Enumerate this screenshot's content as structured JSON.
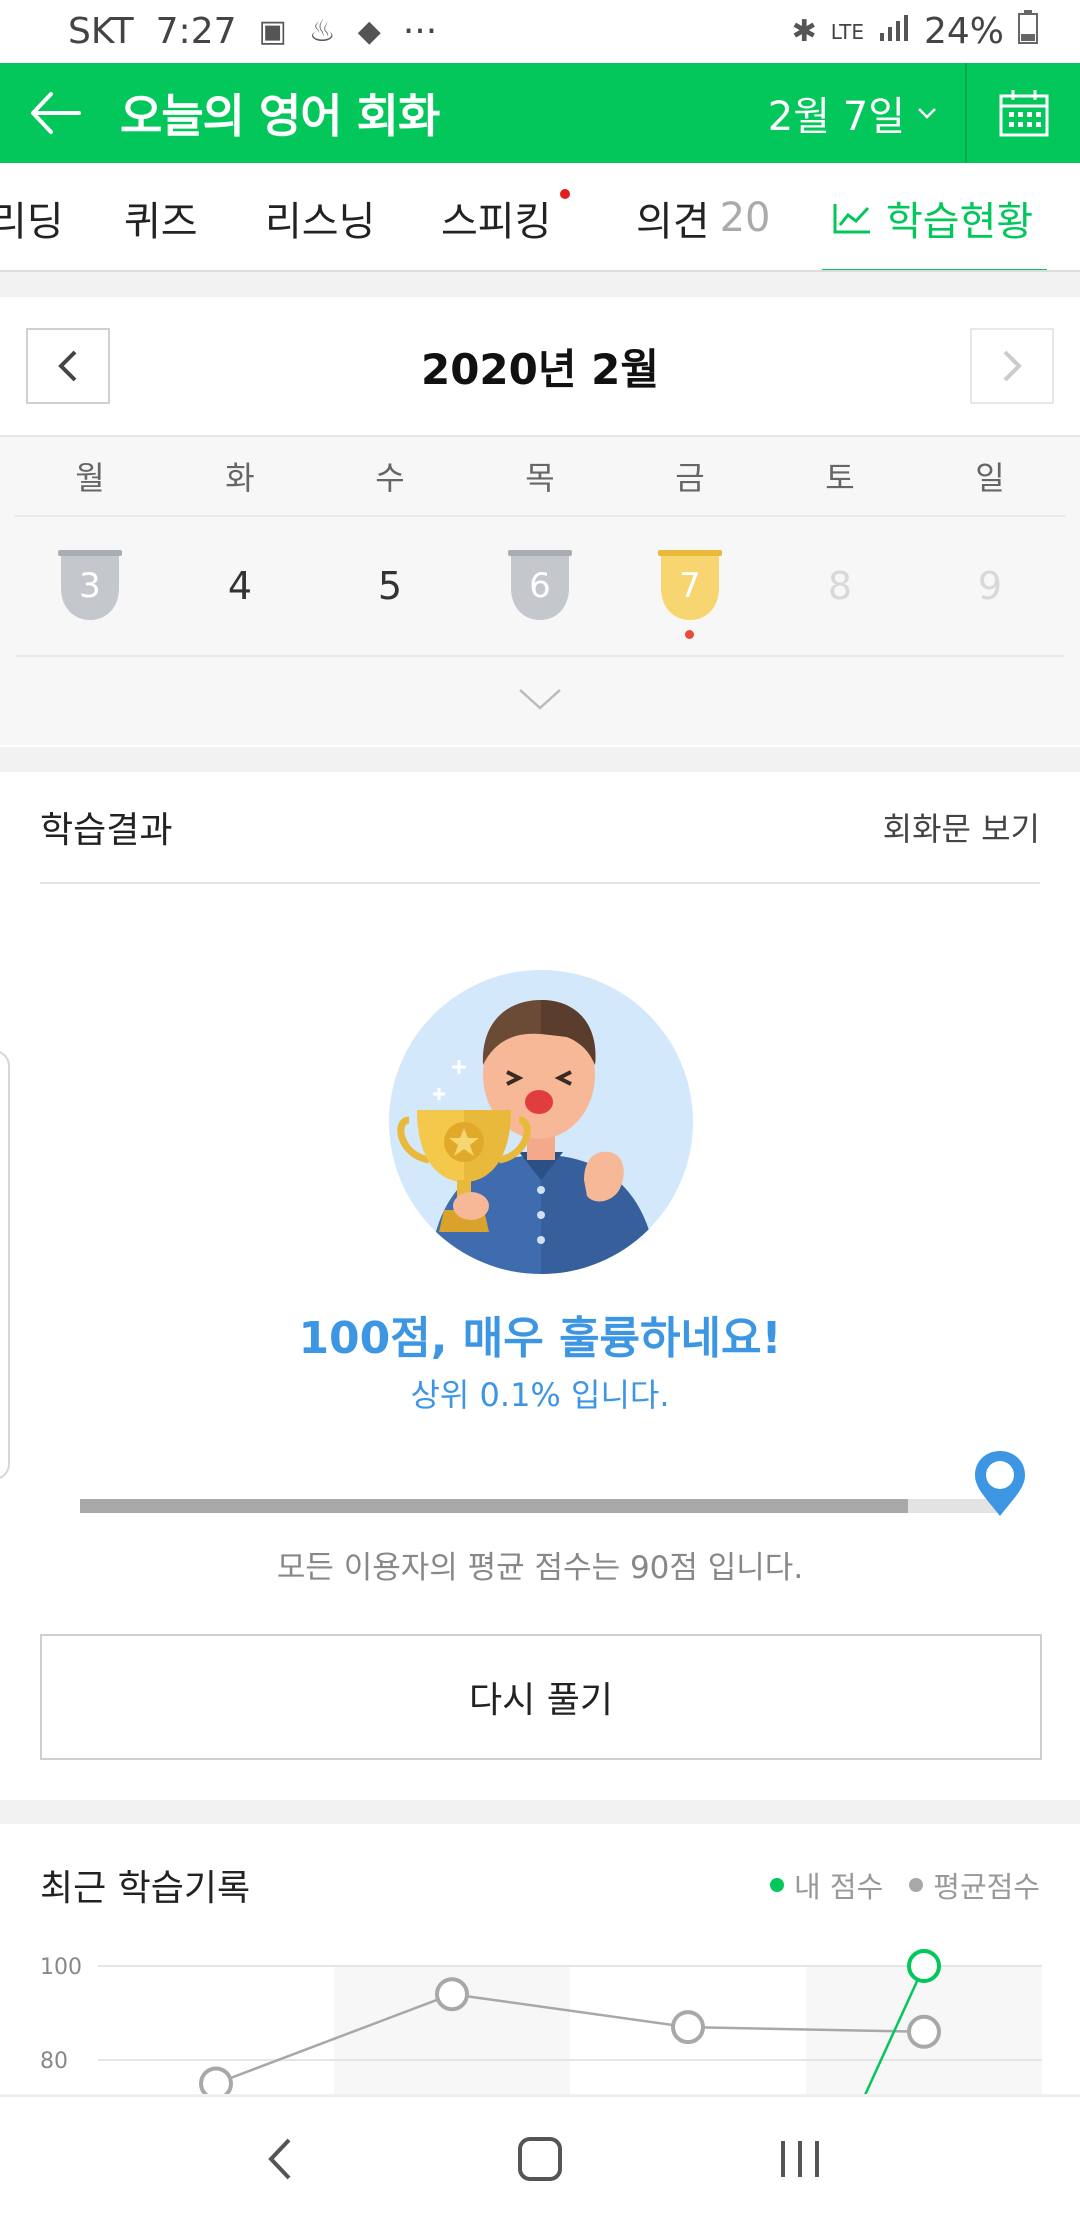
{
  "status_bar": {
    "carrier": "SKT",
    "time": "7:27",
    "more": "···",
    "network": "LTE",
    "battery": "24%"
  },
  "app_bar": {
    "title": "오늘의 영어 회화",
    "date": "2월 7일"
  },
  "tabs": [
    {
      "label": "리딩"
    },
    {
      "label": "퀴즈"
    },
    {
      "label": "리스닝"
    },
    {
      "label": "스피킹",
      "new_dot": true
    },
    {
      "label": "의견",
      "count": "20"
    },
    {
      "label": "학습현황",
      "active": true
    }
  ],
  "calendar": {
    "month_label": "2020년 2월",
    "weekdays": [
      "월",
      "화",
      "수",
      "목",
      "금",
      "토",
      "일"
    ],
    "days": [
      {
        "date": "3",
        "badge": "silver"
      },
      {
        "date": "4",
        "badge": "none"
      },
      {
        "date": "5",
        "badge": "none"
      },
      {
        "date": "6",
        "badge": "silver"
      },
      {
        "date": "7",
        "badge": "gold",
        "today": true
      },
      {
        "date": "8",
        "future": true
      },
      {
        "date": "9",
        "future": true
      }
    ]
  },
  "result": {
    "title": "학습결과",
    "view_link": "회화문 보기",
    "score_message": "100점, 매우 훌륭하네요!",
    "rank_message": "상위 0.1% 입니다.",
    "average_fill": 0.9,
    "my_score_fill": 1.0,
    "average_message": "모든 이용자의 평균 점수는 90점 입니다.",
    "retry_label": "다시 풀기"
  },
  "history": {
    "title": "최근 학습기록",
    "legend_mine": "내 점수",
    "legend_avg": "평균점수",
    "colors": {
      "mine": "#03c75a",
      "avg": "#a8a8a8"
    }
  },
  "chart_data": {
    "type": "line",
    "title": "최근 학습기록",
    "y_ticks": [
      "100",
      "80"
    ],
    "ylim": [
      70,
      100
    ],
    "series": [
      {
        "name": "내 점수",
        "values": [
          null,
          null,
          null,
          100
        ]
      },
      {
        "name": "평균점수",
        "values": [
          75,
          94,
          87,
          86
        ]
      }
    ]
  }
}
